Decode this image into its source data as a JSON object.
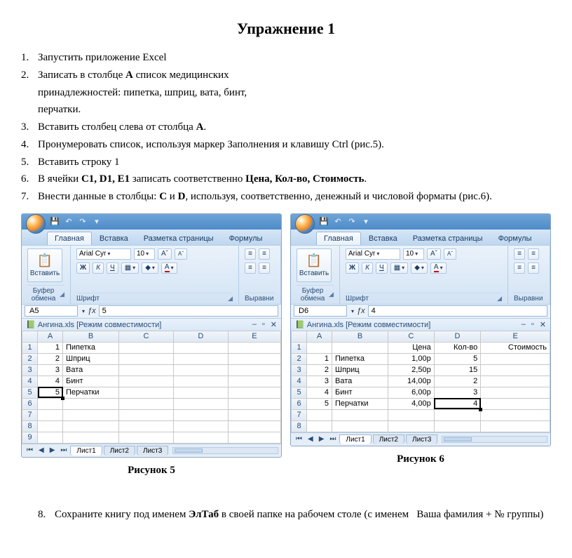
{
  "title": "Упражнение 1",
  "steps": [
    {
      "n": "1.",
      "html": "Запустить приложение Excel"
    },
    {
      "n": "2.",
      "html": "Записать в столбце <b>A</b> список медицинских"
    },
    {
      "cont": true,
      "html": "принадлежностей: пипетка, шприц, вата, бинт,"
    },
    {
      "cont": true,
      "html": "перчатки."
    },
    {
      "n": "3.",
      "html": "Вставить столбец слева от столбца <b>A</b>."
    },
    {
      "n": "4.",
      "html": "Пронумеровать список, используя маркер Заполнения  и клавишу Ctrl (рис.5)."
    },
    {
      "n": "5.",
      "html": "Вставить строку 1"
    },
    {
      "n": "6.",
      "html": "В ячейки <b>C1, D1, E1</b> записать соответственно <b>Цена,  Кол-во, Стоимость</b>."
    },
    {
      "n": "7.",
      "html": "Внести данные в столбцы: <b>C</b> и <b>D</b>, используя, соответственно, денежный и числовой форматы (рис.6)."
    }
  ],
  "excel": {
    "qat_icons": [
      "save-icon",
      "undo-icon",
      "redo-icon"
    ],
    "tabs": [
      "Главная",
      "Вставка",
      "Разметка страницы",
      "Формулы"
    ],
    "clipboard": {
      "paste": "Вставить",
      "label": "Буфер обмена"
    },
    "font": {
      "name": "Arial Cyr",
      "size": "10",
      "bold": "Ж",
      "italic": "К",
      "underline": "Ч",
      "label": "Шрифт"
    },
    "align_label": "Выравни",
    "file_title": "Ангина.xls  [Режим совместимости]",
    "sheet_tabs": [
      "Лист1",
      "Лист2",
      "Лист3"
    ]
  },
  "fig5": {
    "namebox": "A5",
    "fx": "5",
    "cols": [
      "A",
      "B",
      "C",
      "D",
      "E"
    ],
    "rows": [
      [
        "1",
        "Пипетка",
        "",
        "",
        ""
      ],
      [
        "2",
        "Шприц",
        "",
        "",
        ""
      ],
      [
        "3",
        "Вата",
        "",
        "",
        ""
      ],
      [
        "4",
        "Бинт",
        "",
        "",
        ""
      ],
      [
        "5",
        "Перчатки",
        "",
        "",
        ""
      ],
      [
        "",
        "",
        "",
        "",
        ""
      ],
      [
        "",
        "",
        "",
        "",
        ""
      ],
      [
        "",
        "",
        "",
        "",
        ""
      ],
      [
        "",
        "",
        "",
        "",
        ""
      ]
    ],
    "sel": [
      4,
      0
    ],
    "caption": "Рисунок 5"
  },
  "fig6": {
    "namebox": "D6",
    "fx": "4",
    "cols": [
      "A",
      "B",
      "C",
      "D",
      "E"
    ],
    "rows": [
      [
        "",
        "",
        "Цена",
        "Кол-во",
        "Стоимость"
      ],
      [
        "1",
        "Пипетка",
        "1,00р",
        "5",
        ""
      ],
      [
        "2",
        "Шприц",
        "2,50р",
        "15",
        ""
      ],
      [
        "3",
        "Вата",
        "14,00р",
        "2",
        ""
      ],
      [
        "4",
        "Бинт",
        "6,00р",
        "3",
        ""
      ],
      [
        "5",
        "Перчатки",
        "4,00р",
        "4",
        ""
      ],
      [
        "",
        "",
        "",
        "",
        ""
      ],
      [
        "",
        "",
        "",
        "",
        ""
      ]
    ],
    "sel": [
      5,
      3
    ],
    "caption": "Рисунок 6"
  },
  "step8": {
    "n": "8.",
    "html": "Сохраните книгу под именем <b>ЭлТаб</b> в своей папке на рабочем столе (с именем &nbsp;&nbsp;Ваша фамилия + № группы)"
  }
}
